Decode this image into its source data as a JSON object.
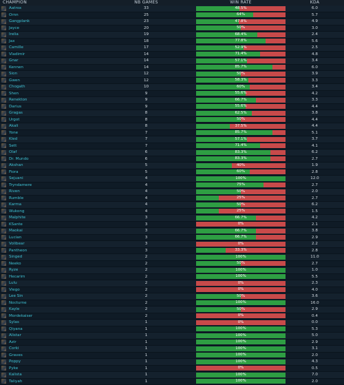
{
  "header": {
    "champion": "CHAMPION",
    "games": "NB GAMES",
    "winrate": "WIN RATE",
    "kda": "KDA"
  },
  "colors": {
    "win": "#2e9e43",
    "loss": "#c84a4a",
    "name": "#3fc2d4"
  },
  "rows": [
    {
      "name": "Aatrox",
      "games": "33",
      "wr": "48.5%",
      "kda": "6.0"
    },
    {
      "name": "Ornn",
      "games": "25",
      "wr": "64%",
      "kda": "5.7"
    },
    {
      "name": "Gangplank",
      "games": "23",
      "wr": "47.8%",
      "kda": "4.9"
    },
    {
      "name": "Jayce",
      "games": "20",
      "wr": "50%",
      "kda": "3.0"
    },
    {
      "name": "Irelia",
      "games": "19",
      "wr": "68.4%",
      "kda": "2.4"
    },
    {
      "name": "Jax",
      "games": "18",
      "wr": "77.8%",
      "kda": "5.6"
    },
    {
      "name": "Camille",
      "games": "17",
      "wr": "52.9%",
      "kda": "2.5"
    },
    {
      "name": "Vladimir",
      "games": "14",
      "wr": "71.4%",
      "kda": "4.8"
    },
    {
      "name": "Gnar",
      "games": "14",
      "wr": "57.1%",
      "kda": "3.4"
    },
    {
      "name": "Kennen",
      "games": "14",
      "wr": "85.7%",
      "kda": "6.0"
    },
    {
      "name": "Sion",
      "games": "12",
      "wr": "50%",
      "kda": "3.9"
    },
    {
      "name": "Gwen",
      "games": "12",
      "wr": "58.3%",
      "kda": "3.3"
    },
    {
      "name": "Chogath",
      "games": "10",
      "wr": "60%",
      "kda": "3.4"
    },
    {
      "name": "Shen",
      "games": "9",
      "wr": "55.6%",
      "kda": "4.2"
    },
    {
      "name": "Renekton",
      "games": "9",
      "wr": "66.7%",
      "kda": "3.3"
    },
    {
      "name": "Darius",
      "games": "9",
      "wr": "55.6%",
      "kda": "4.4"
    },
    {
      "name": "Gragas",
      "games": "8",
      "wr": "62.5%",
      "kda": "3.8"
    },
    {
      "name": "Urgot",
      "games": "8",
      "wr": "50%",
      "kda": "4.4"
    },
    {
      "name": "Akali",
      "games": "8",
      "wr": "37.5%",
      "kda": "4.4"
    },
    {
      "name": "Yone",
      "games": "7",
      "wr": "85.7%",
      "kda": "5.1"
    },
    {
      "name": "Kled",
      "games": "7",
      "wr": "57.1%",
      "kda": "3.7"
    },
    {
      "name": "Sett",
      "games": "7",
      "wr": "71.4%",
      "kda": "4.1"
    },
    {
      "name": "Olaf",
      "games": "6",
      "wr": "83.3%",
      "kda": "6.2"
    },
    {
      "name": "Dr. Mundo",
      "games": "6",
      "wr": "83.3%",
      "kda": "2.7"
    },
    {
      "name": "Akshan",
      "games": "5",
      "wr": "40%",
      "kda": "1.9"
    },
    {
      "name": "Fiora",
      "games": "5",
      "wr": "60%",
      "kda": "2.8"
    },
    {
      "name": "Sejuani",
      "games": "4",
      "wr": "100%",
      "kda": "12.0"
    },
    {
      "name": "Tryndamere",
      "games": "4",
      "wr": "75%",
      "kda": "2.7"
    },
    {
      "name": "Riven",
      "games": "4",
      "wr": "50%",
      "kda": "2.0"
    },
    {
      "name": "Rumble",
      "games": "4",
      "wr": "25%",
      "kda": "2.7"
    },
    {
      "name": "Karma",
      "games": "4",
      "wr": "50%",
      "kda": "6.2"
    },
    {
      "name": "Wukong",
      "games": "4",
      "wr": "25%",
      "kda": "1.5"
    },
    {
      "name": "Malphite",
      "games": "3",
      "wr": "66.7%",
      "kda": "4.2"
    },
    {
      "name": "KSante",
      "games": "3",
      "wr": "0%",
      "kda": "2.1"
    },
    {
      "name": "Maokai",
      "games": "3",
      "wr": "66.7%",
      "kda": "3.8"
    },
    {
      "name": "Lucian",
      "games": "3",
      "wr": "66.7%",
      "kda": "2.9"
    },
    {
      "name": "Volibear",
      "games": "3",
      "wr": "0%",
      "kda": "2.2"
    },
    {
      "name": "Pantheon",
      "games": "3",
      "wr": "33.3%",
      "kda": "2.8"
    },
    {
      "name": "Singed",
      "games": "2",
      "wr": "100%",
      "kda": "11.0"
    },
    {
      "name": "Neeko",
      "games": "2",
      "wr": "50%",
      "kda": "2.7"
    },
    {
      "name": "Ryze",
      "games": "2",
      "wr": "100%",
      "kda": "1.0"
    },
    {
      "name": "Hecarim",
      "games": "2",
      "wr": "100%",
      "kda": "5.5"
    },
    {
      "name": "Lulu",
      "games": "2",
      "wr": "0%",
      "kda": "2.3"
    },
    {
      "name": "Viego",
      "games": "2",
      "wr": "0%",
      "kda": "4.0"
    },
    {
      "name": "Lee Sin",
      "games": "2",
      "wr": "50%",
      "kda": "3.6"
    },
    {
      "name": "Nocturne",
      "games": "2",
      "wr": "100%",
      "kda": "16.0"
    },
    {
      "name": "Kayle",
      "games": "2",
      "wr": "50%",
      "kda": "2.9"
    },
    {
      "name": "Mordekaiser",
      "games": "2",
      "wr": "0%",
      "kda": "0.4"
    },
    {
      "name": "Sylas",
      "games": "1",
      "wr": "0%",
      "kda": "0.0"
    },
    {
      "name": "Qiyana",
      "games": "1",
      "wr": "100%",
      "kda": "5.3"
    },
    {
      "name": "Alistar",
      "games": "1",
      "wr": "100%",
      "kda": "5.0"
    },
    {
      "name": "Azir",
      "games": "1",
      "wr": "100%",
      "kda": "2.9"
    },
    {
      "name": "Corki",
      "games": "1",
      "wr": "100%",
      "kda": "3.1"
    },
    {
      "name": "Graves",
      "games": "1",
      "wr": "100%",
      "kda": "2.0"
    },
    {
      "name": "Poppy",
      "games": "1",
      "wr": "100%",
      "kda": "4.3"
    },
    {
      "name": "Pyke",
      "games": "1",
      "wr": "0%",
      "kda": "0.5"
    },
    {
      "name": "Kalista",
      "games": "1",
      "wr": "100%",
      "kda": "7.0"
    },
    {
      "name": "Taliyah",
      "games": "1",
      "wr": "100%",
      "kda": "2.0"
    }
  ]
}
